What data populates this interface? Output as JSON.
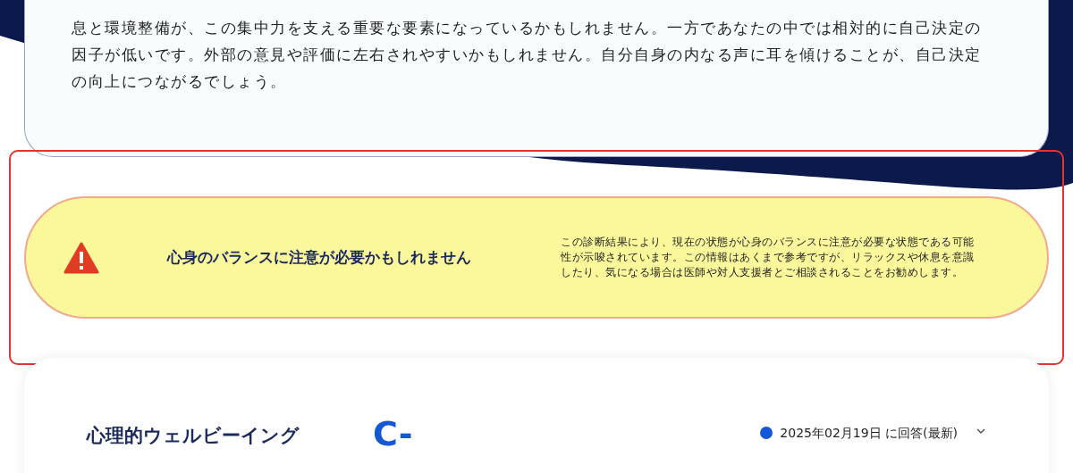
{
  "summary": {
    "text": "息と環境整備が、この集中力を支える重要な要素になっているかもしれません。一方であなたの中では相対的に自己決定の因子が低いです。外部の意見や評価に左右されやすいかもしれません。自分自身の内なる声に耳を傾けることが、自己決定の向上につながるでしょう。"
  },
  "alert": {
    "title": "心身のバランスに注意が必要かもしれません",
    "message": "この診断結果により、現在の状態が心身のバランスに注意が必要な状態である可能性が示唆されています。この情報はあくまで参考ですが、リラックスや休息を意識したり、気になる場合は医師や対人支援者とご相談されることをお勧めします。",
    "highlighted": true
  },
  "section": {
    "title": "心理的ウェルビーイング",
    "grade": "C-",
    "date": "2025年02月19日 に回答(最新)",
    "expanded": false
  }
}
